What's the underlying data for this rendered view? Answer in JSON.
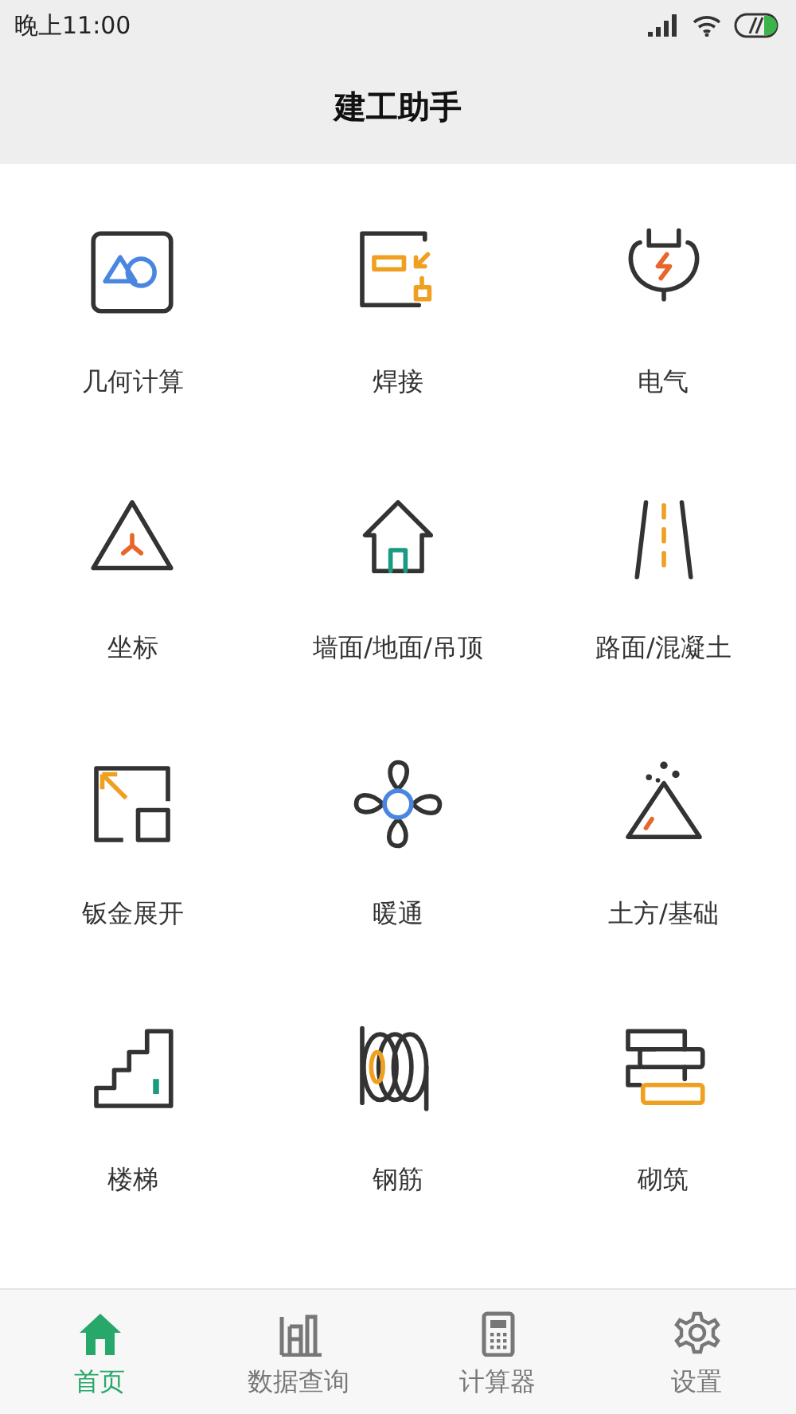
{
  "status_bar": {
    "time": "晚上11:00"
  },
  "header": {
    "title": "建工助手"
  },
  "tools": [
    {
      "label": "几何计算",
      "kind": "geometry"
    },
    {
      "label": "焊接",
      "kind": "welding"
    },
    {
      "label": "电气",
      "kind": "electric"
    },
    {
      "label": "坐标",
      "kind": "coordinate"
    },
    {
      "label": "墙面/地面/吊顶",
      "kind": "house"
    },
    {
      "label": "路面/混凝土",
      "kind": "road"
    },
    {
      "label": "钣金展开",
      "kind": "sheet"
    },
    {
      "label": "暖通",
      "kind": "fan"
    },
    {
      "label": "土方/基础",
      "kind": "earth"
    },
    {
      "label": "楼梯",
      "kind": "stairs"
    },
    {
      "label": "钢筋",
      "kind": "rebar"
    },
    {
      "label": "砌筑",
      "kind": "masonry"
    }
  ],
  "bottom_nav": [
    {
      "label": "首页",
      "kind": "home",
      "selected": true
    },
    {
      "label": "数据查询",
      "kind": "books",
      "selected": false
    },
    {
      "label": "计算器",
      "kind": "calculator",
      "selected": false
    },
    {
      "label": "设置",
      "kind": "settings",
      "selected": false
    }
  ]
}
